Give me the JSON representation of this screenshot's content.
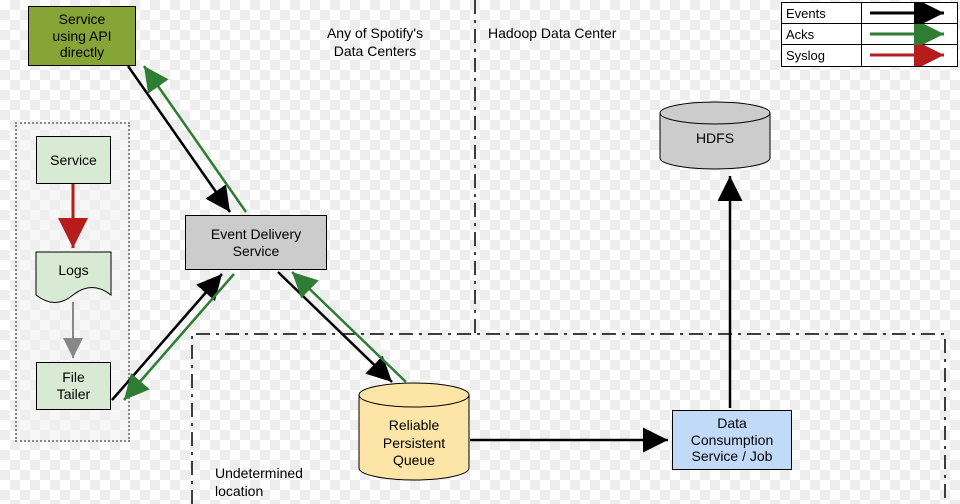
{
  "regions": {
    "spotify_dc": "Any of Spotify's\nData Centers",
    "hadoop_dc": "Hadoop Data Center",
    "undetermined": "Undetermined\nlocation"
  },
  "nodes": {
    "service_api": "Service\nusing API\ndirectly",
    "service": "Service",
    "logs": "Logs",
    "file_tailer": "File\nTailer",
    "event_delivery": "Event Delivery\nService",
    "queue": "Reliable\nPersistent\nQueue",
    "data_consumption": "Data\nConsumption\nService / Job",
    "hdfs": "HDFS"
  },
  "legend": {
    "events": "Events",
    "acks": "Acks",
    "syslog": "Syslog"
  },
  "colors": {
    "olive": "#87a436",
    "pale_green": "#d8ead3",
    "grey": "#cccccc",
    "yellow": "#fce5a7",
    "blue": "#c1daf8",
    "arrow_black": "#000000",
    "arrow_green": "#2e7d32",
    "arrow_red": "#b71c1c"
  }
}
